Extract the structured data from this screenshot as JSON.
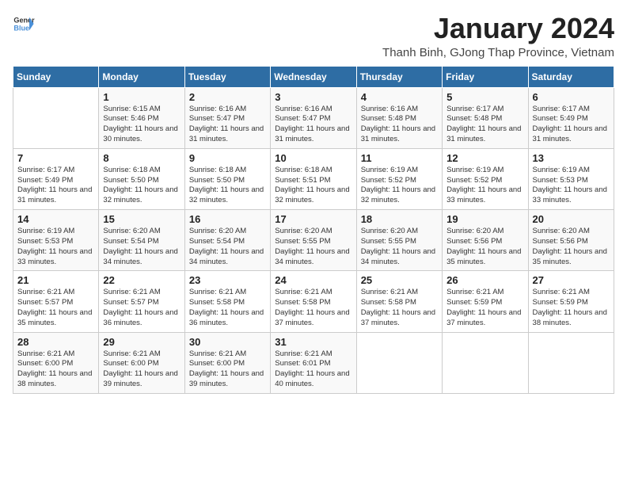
{
  "logo": {
    "line1": "General",
    "line2": "Blue"
  },
  "title": "January 2024",
  "subtitle": "Thanh Binh, GJong Thap Province, Vietnam",
  "headers": [
    "Sunday",
    "Monday",
    "Tuesday",
    "Wednesday",
    "Thursday",
    "Friday",
    "Saturday"
  ],
  "weeks": [
    [
      {
        "day": "",
        "sunrise": "",
        "sunset": "",
        "daylight": ""
      },
      {
        "day": "1",
        "sunrise": "Sunrise: 6:15 AM",
        "sunset": "Sunset: 5:46 PM",
        "daylight": "Daylight: 11 hours and 30 minutes."
      },
      {
        "day": "2",
        "sunrise": "Sunrise: 6:16 AM",
        "sunset": "Sunset: 5:47 PM",
        "daylight": "Daylight: 11 hours and 31 minutes."
      },
      {
        "day": "3",
        "sunrise": "Sunrise: 6:16 AM",
        "sunset": "Sunset: 5:47 PM",
        "daylight": "Daylight: 11 hours and 31 minutes."
      },
      {
        "day": "4",
        "sunrise": "Sunrise: 6:16 AM",
        "sunset": "Sunset: 5:48 PM",
        "daylight": "Daylight: 11 hours and 31 minutes."
      },
      {
        "day": "5",
        "sunrise": "Sunrise: 6:17 AM",
        "sunset": "Sunset: 5:48 PM",
        "daylight": "Daylight: 11 hours and 31 minutes."
      },
      {
        "day": "6",
        "sunrise": "Sunrise: 6:17 AM",
        "sunset": "Sunset: 5:49 PM",
        "daylight": "Daylight: 11 hours and 31 minutes."
      }
    ],
    [
      {
        "day": "7",
        "sunrise": "Sunrise: 6:17 AM",
        "sunset": "Sunset: 5:49 PM",
        "daylight": "Daylight: 11 hours and 31 minutes."
      },
      {
        "day": "8",
        "sunrise": "Sunrise: 6:18 AM",
        "sunset": "Sunset: 5:50 PM",
        "daylight": "Daylight: 11 hours and 32 minutes."
      },
      {
        "day": "9",
        "sunrise": "Sunrise: 6:18 AM",
        "sunset": "Sunset: 5:50 PM",
        "daylight": "Daylight: 11 hours and 32 minutes."
      },
      {
        "day": "10",
        "sunrise": "Sunrise: 6:18 AM",
        "sunset": "Sunset: 5:51 PM",
        "daylight": "Daylight: 11 hours and 32 minutes."
      },
      {
        "day": "11",
        "sunrise": "Sunrise: 6:19 AM",
        "sunset": "Sunset: 5:52 PM",
        "daylight": "Daylight: 11 hours and 32 minutes."
      },
      {
        "day": "12",
        "sunrise": "Sunrise: 6:19 AM",
        "sunset": "Sunset: 5:52 PM",
        "daylight": "Daylight: 11 hours and 33 minutes."
      },
      {
        "day": "13",
        "sunrise": "Sunrise: 6:19 AM",
        "sunset": "Sunset: 5:53 PM",
        "daylight": "Daylight: 11 hours and 33 minutes."
      }
    ],
    [
      {
        "day": "14",
        "sunrise": "Sunrise: 6:19 AM",
        "sunset": "Sunset: 5:53 PM",
        "daylight": "Daylight: 11 hours and 33 minutes."
      },
      {
        "day": "15",
        "sunrise": "Sunrise: 6:20 AM",
        "sunset": "Sunset: 5:54 PM",
        "daylight": "Daylight: 11 hours and 34 minutes."
      },
      {
        "day": "16",
        "sunrise": "Sunrise: 6:20 AM",
        "sunset": "Sunset: 5:54 PM",
        "daylight": "Daylight: 11 hours and 34 minutes."
      },
      {
        "day": "17",
        "sunrise": "Sunrise: 6:20 AM",
        "sunset": "Sunset: 5:55 PM",
        "daylight": "Daylight: 11 hours and 34 minutes."
      },
      {
        "day": "18",
        "sunrise": "Sunrise: 6:20 AM",
        "sunset": "Sunset: 5:55 PM",
        "daylight": "Daylight: 11 hours and 34 minutes."
      },
      {
        "day": "19",
        "sunrise": "Sunrise: 6:20 AM",
        "sunset": "Sunset: 5:56 PM",
        "daylight": "Daylight: 11 hours and 35 minutes."
      },
      {
        "day": "20",
        "sunrise": "Sunrise: 6:20 AM",
        "sunset": "Sunset: 5:56 PM",
        "daylight": "Daylight: 11 hours and 35 minutes."
      }
    ],
    [
      {
        "day": "21",
        "sunrise": "Sunrise: 6:21 AM",
        "sunset": "Sunset: 5:57 PM",
        "daylight": "Daylight: 11 hours and 35 minutes."
      },
      {
        "day": "22",
        "sunrise": "Sunrise: 6:21 AM",
        "sunset": "Sunset: 5:57 PM",
        "daylight": "Daylight: 11 hours and 36 minutes."
      },
      {
        "day": "23",
        "sunrise": "Sunrise: 6:21 AM",
        "sunset": "Sunset: 5:58 PM",
        "daylight": "Daylight: 11 hours and 36 minutes."
      },
      {
        "day": "24",
        "sunrise": "Sunrise: 6:21 AM",
        "sunset": "Sunset: 5:58 PM",
        "daylight": "Daylight: 11 hours and 37 minutes."
      },
      {
        "day": "25",
        "sunrise": "Sunrise: 6:21 AM",
        "sunset": "Sunset: 5:58 PM",
        "daylight": "Daylight: 11 hours and 37 minutes."
      },
      {
        "day": "26",
        "sunrise": "Sunrise: 6:21 AM",
        "sunset": "Sunset: 5:59 PM",
        "daylight": "Daylight: 11 hours and 37 minutes."
      },
      {
        "day": "27",
        "sunrise": "Sunrise: 6:21 AM",
        "sunset": "Sunset: 5:59 PM",
        "daylight": "Daylight: 11 hours and 38 minutes."
      }
    ],
    [
      {
        "day": "28",
        "sunrise": "Sunrise: 6:21 AM",
        "sunset": "Sunset: 6:00 PM",
        "daylight": "Daylight: 11 hours and 38 minutes."
      },
      {
        "day": "29",
        "sunrise": "Sunrise: 6:21 AM",
        "sunset": "Sunset: 6:00 PM",
        "daylight": "Daylight: 11 hours and 39 minutes."
      },
      {
        "day": "30",
        "sunrise": "Sunrise: 6:21 AM",
        "sunset": "Sunset: 6:00 PM",
        "daylight": "Daylight: 11 hours and 39 minutes."
      },
      {
        "day": "31",
        "sunrise": "Sunrise: 6:21 AM",
        "sunset": "Sunset: 6:01 PM",
        "daylight": "Daylight: 11 hours and 40 minutes."
      },
      {
        "day": "",
        "sunrise": "",
        "sunset": "",
        "daylight": ""
      },
      {
        "day": "",
        "sunrise": "",
        "sunset": "",
        "daylight": ""
      },
      {
        "day": "",
        "sunrise": "",
        "sunset": "",
        "daylight": ""
      }
    ]
  ]
}
